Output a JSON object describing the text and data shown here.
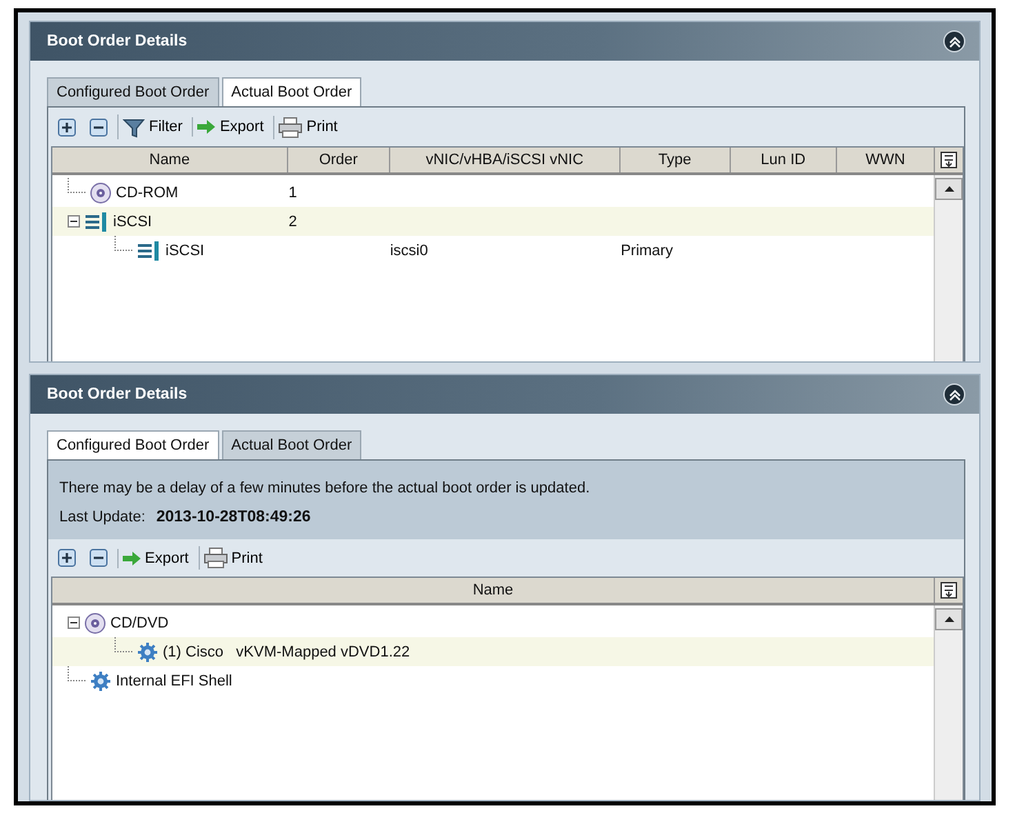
{
  "panels": [
    {
      "title": "Boot Order Details",
      "tabs": [
        {
          "label": "Configured Boot Order",
          "selected": true
        },
        {
          "label": "Actual Boot Order",
          "selected": false
        }
      ],
      "toolbar": [
        {
          "kind": "expand"
        },
        {
          "kind": "collapse"
        },
        {
          "kind": "filter",
          "label": "Filter"
        },
        {
          "kind": "export",
          "label": "Export"
        },
        {
          "kind": "print",
          "label": "Print"
        }
      ],
      "table": {
        "columns": [
          "Name",
          "Order",
          "vNIC/vHBA/iSCSI vNIC",
          "Type",
          "Lun ID",
          "WWN"
        ],
        "rows": [
          {
            "kind": "disc",
            "name": "CD-ROM",
            "order": "1",
            "selected": false
          },
          {
            "kind": "iscsi",
            "name": "iSCSI",
            "order": "2",
            "selected": true,
            "expanded": true,
            "children": [
              {
                "kind": "iscsi",
                "name": "iSCSI",
                "vnic": "iscsi0",
                "type": "Primary",
                "selected": false
              }
            ]
          }
        ]
      }
    },
    {
      "title": "Boot Order Details",
      "tabs": [
        {
          "label": "Configured Boot Order",
          "selected": false
        },
        {
          "label": "Actual Boot Order",
          "selected": true
        }
      ],
      "notice": {
        "message": "There may be a delay of a few minutes before the actual boot order is updated.",
        "last_update_label": "Last Update:",
        "last_update_value": "2013-10-28T08:49:26"
      },
      "toolbar": [
        {
          "kind": "expand"
        },
        {
          "kind": "collapse"
        },
        {
          "kind": "export",
          "label": "Export"
        },
        {
          "kind": "print",
          "label": "Print"
        }
      ],
      "table": {
        "columns": [
          "Name"
        ],
        "rows": [
          {
            "kind": "disc",
            "name": "CD/DVD",
            "selected": false,
            "expanded": true,
            "children": [
              {
                "kind": "gear",
                "name": "(1) Cisco   vKVM-Mapped vDVD1.22",
                "selected": true
              }
            ]
          },
          {
            "kind": "gear",
            "name": "Internal EFI Shell",
            "selected": false
          }
        ]
      }
    }
  ]
}
